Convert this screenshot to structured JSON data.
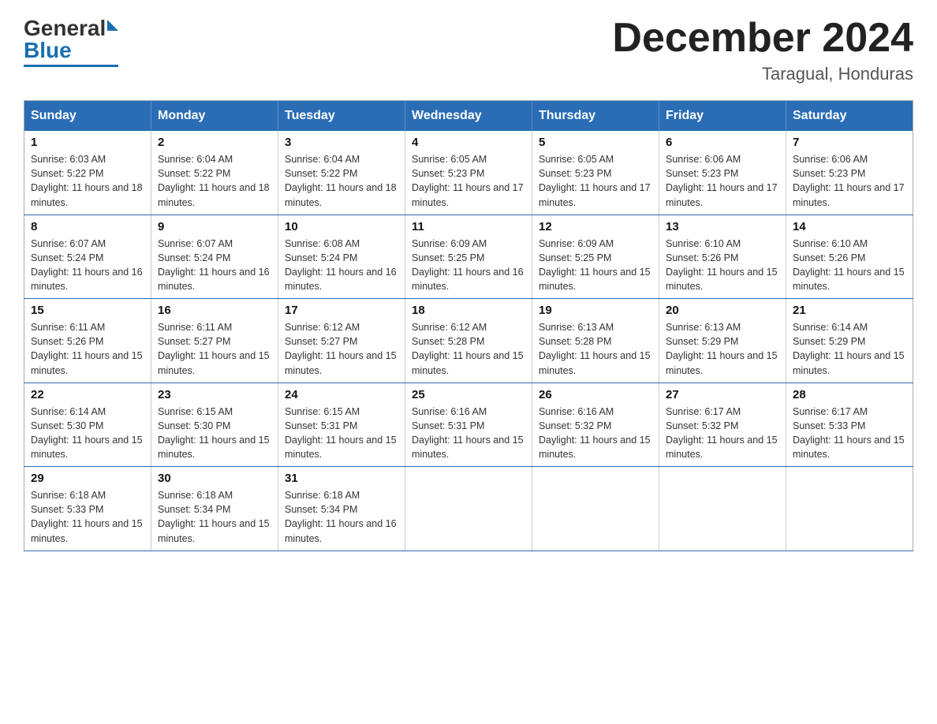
{
  "logo": {
    "general": "General",
    "blue": "Blue"
  },
  "title": {
    "month_year": "December 2024",
    "location": "Taragual, Honduras"
  },
  "weekdays": [
    "Sunday",
    "Monday",
    "Tuesday",
    "Wednesday",
    "Thursday",
    "Friday",
    "Saturday"
  ],
  "weeks": [
    [
      {
        "day": "1",
        "sunrise": "6:03 AM",
        "sunset": "5:22 PM",
        "daylight": "11 hours and 18 minutes."
      },
      {
        "day": "2",
        "sunrise": "6:04 AM",
        "sunset": "5:22 PM",
        "daylight": "11 hours and 18 minutes."
      },
      {
        "day": "3",
        "sunrise": "6:04 AM",
        "sunset": "5:22 PM",
        "daylight": "11 hours and 18 minutes."
      },
      {
        "day": "4",
        "sunrise": "6:05 AM",
        "sunset": "5:23 PM",
        "daylight": "11 hours and 17 minutes."
      },
      {
        "day": "5",
        "sunrise": "6:05 AM",
        "sunset": "5:23 PM",
        "daylight": "11 hours and 17 minutes."
      },
      {
        "day": "6",
        "sunrise": "6:06 AM",
        "sunset": "5:23 PM",
        "daylight": "11 hours and 17 minutes."
      },
      {
        "day": "7",
        "sunrise": "6:06 AM",
        "sunset": "5:23 PM",
        "daylight": "11 hours and 17 minutes."
      }
    ],
    [
      {
        "day": "8",
        "sunrise": "6:07 AM",
        "sunset": "5:24 PM",
        "daylight": "11 hours and 16 minutes."
      },
      {
        "day": "9",
        "sunrise": "6:07 AM",
        "sunset": "5:24 PM",
        "daylight": "11 hours and 16 minutes."
      },
      {
        "day": "10",
        "sunrise": "6:08 AM",
        "sunset": "5:24 PM",
        "daylight": "11 hours and 16 minutes."
      },
      {
        "day": "11",
        "sunrise": "6:09 AM",
        "sunset": "5:25 PM",
        "daylight": "11 hours and 16 minutes."
      },
      {
        "day": "12",
        "sunrise": "6:09 AM",
        "sunset": "5:25 PM",
        "daylight": "11 hours and 15 minutes."
      },
      {
        "day": "13",
        "sunrise": "6:10 AM",
        "sunset": "5:26 PM",
        "daylight": "11 hours and 15 minutes."
      },
      {
        "day": "14",
        "sunrise": "6:10 AM",
        "sunset": "5:26 PM",
        "daylight": "11 hours and 15 minutes."
      }
    ],
    [
      {
        "day": "15",
        "sunrise": "6:11 AM",
        "sunset": "5:26 PM",
        "daylight": "11 hours and 15 minutes."
      },
      {
        "day": "16",
        "sunrise": "6:11 AM",
        "sunset": "5:27 PM",
        "daylight": "11 hours and 15 minutes."
      },
      {
        "day": "17",
        "sunrise": "6:12 AM",
        "sunset": "5:27 PM",
        "daylight": "11 hours and 15 minutes."
      },
      {
        "day": "18",
        "sunrise": "6:12 AM",
        "sunset": "5:28 PM",
        "daylight": "11 hours and 15 minutes."
      },
      {
        "day": "19",
        "sunrise": "6:13 AM",
        "sunset": "5:28 PM",
        "daylight": "11 hours and 15 minutes."
      },
      {
        "day": "20",
        "sunrise": "6:13 AM",
        "sunset": "5:29 PM",
        "daylight": "11 hours and 15 minutes."
      },
      {
        "day": "21",
        "sunrise": "6:14 AM",
        "sunset": "5:29 PM",
        "daylight": "11 hours and 15 minutes."
      }
    ],
    [
      {
        "day": "22",
        "sunrise": "6:14 AM",
        "sunset": "5:30 PM",
        "daylight": "11 hours and 15 minutes."
      },
      {
        "day": "23",
        "sunrise": "6:15 AM",
        "sunset": "5:30 PM",
        "daylight": "11 hours and 15 minutes."
      },
      {
        "day": "24",
        "sunrise": "6:15 AM",
        "sunset": "5:31 PM",
        "daylight": "11 hours and 15 minutes."
      },
      {
        "day": "25",
        "sunrise": "6:16 AM",
        "sunset": "5:31 PM",
        "daylight": "11 hours and 15 minutes."
      },
      {
        "day": "26",
        "sunrise": "6:16 AM",
        "sunset": "5:32 PM",
        "daylight": "11 hours and 15 minutes."
      },
      {
        "day": "27",
        "sunrise": "6:17 AM",
        "sunset": "5:32 PM",
        "daylight": "11 hours and 15 minutes."
      },
      {
        "day": "28",
        "sunrise": "6:17 AM",
        "sunset": "5:33 PM",
        "daylight": "11 hours and 15 minutes."
      }
    ],
    [
      {
        "day": "29",
        "sunrise": "6:18 AM",
        "sunset": "5:33 PM",
        "daylight": "11 hours and 15 minutes."
      },
      {
        "day": "30",
        "sunrise": "6:18 AM",
        "sunset": "5:34 PM",
        "daylight": "11 hours and 15 minutes."
      },
      {
        "day": "31",
        "sunrise": "6:18 AM",
        "sunset": "5:34 PM",
        "daylight": "11 hours and 16 minutes."
      },
      null,
      null,
      null,
      null
    ]
  ]
}
